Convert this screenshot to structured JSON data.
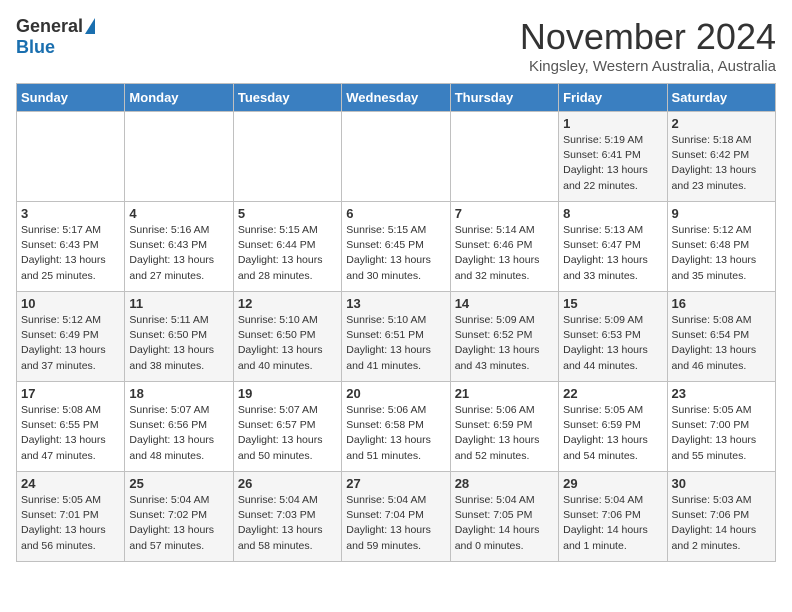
{
  "logo": {
    "general": "General",
    "blue": "Blue"
  },
  "title": "November 2024",
  "subtitle": "Kingsley, Western Australia, Australia",
  "headers": [
    "Sunday",
    "Monday",
    "Tuesday",
    "Wednesday",
    "Thursday",
    "Friday",
    "Saturday"
  ],
  "weeks": [
    [
      {
        "day": "",
        "info": ""
      },
      {
        "day": "",
        "info": ""
      },
      {
        "day": "",
        "info": ""
      },
      {
        "day": "",
        "info": ""
      },
      {
        "day": "",
        "info": ""
      },
      {
        "day": "1",
        "info": "Sunrise: 5:19 AM\nSunset: 6:41 PM\nDaylight: 13 hours\nand 22 minutes."
      },
      {
        "day": "2",
        "info": "Sunrise: 5:18 AM\nSunset: 6:42 PM\nDaylight: 13 hours\nand 23 minutes."
      }
    ],
    [
      {
        "day": "3",
        "info": "Sunrise: 5:17 AM\nSunset: 6:43 PM\nDaylight: 13 hours\nand 25 minutes."
      },
      {
        "day": "4",
        "info": "Sunrise: 5:16 AM\nSunset: 6:43 PM\nDaylight: 13 hours\nand 27 minutes."
      },
      {
        "day": "5",
        "info": "Sunrise: 5:15 AM\nSunset: 6:44 PM\nDaylight: 13 hours\nand 28 minutes."
      },
      {
        "day": "6",
        "info": "Sunrise: 5:15 AM\nSunset: 6:45 PM\nDaylight: 13 hours\nand 30 minutes."
      },
      {
        "day": "7",
        "info": "Sunrise: 5:14 AM\nSunset: 6:46 PM\nDaylight: 13 hours\nand 32 minutes."
      },
      {
        "day": "8",
        "info": "Sunrise: 5:13 AM\nSunset: 6:47 PM\nDaylight: 13 hours\nand 33 minutes."
      },
      {
        "day": "9",
        "info": "Sunrise: 5:12 AM\nSunset: 6:48 PM\nDaylight: 13 hours\nand 35 minutes."
      }
    ],
    [
      {
        "day": "10",
        "info": "Sunrise: 5:12 AM\nSunset: 6:49 PM\nDaylight: 13 hours\nand 37 minutes."
      },
      {
        "day": "11",
        "info": "Sunrise: 5:11 AM\nSunset: 6:50 PM\nDaylight: 13 hours\nand 38 minutes."
      },
      {
        "day": "12",
        "info": "Sunrise: 5:10 AM\nSunset: 6:50 PM\nDaylight: 13 hours\nand 40 minutes."
      },
      {
        "day": "13",
        "info": "Sunrise: 5:10 AM\nSunset: 6:51 PM\nDaylight: 13 hours\nand 41 minutes."
      },
      {
        "day": "14",
        "info": "Sunrise: 5:09 AM\nSunset: 6:52 PM\nDaylight: 13 hours\nand 43 minutes."
      },
      {
        "day": "15",
        "info": "Sunrise: 5:09 AM\nSunset: 6:53 PM\nDaylight: 13 hours\nand 44 minutes."
      },
      {
        "day": "16",
        "info": "Sunrise: 5:08 AM\nSunset: 6:54 PM\nDaylight: 13 hours\nand 46 minutes."
      }
    ],
    [
      {
        "day": "17",
        "info": "Sunrise: 5:08 AM\nSunset: 6:55 PM\nDaylight: 13 hours\nand 47 minutes."
      },
      {
        "day": "18",
        "info": "Sunrise: 5:07 AM\nSunset: 6:56 PM\nDaylight: 13 hours\nand 48 minutes."
      },
      {
        "day": "19",
        "info": "Sunrise: 5:07 AM\nSunset: 6:57 PM\nDaylight: 13 hours\nand 50 minutes."
      },
      {
        "day": "20",
        "info": "Sunrise: 5:06 AM\nSunset: 6:58 PM\nDaylight: 13 hours\nand 51 minutes."
      },
      {
        "day": "21",
        "info": "Sunrise: 5:06 AM\nSunset: 6:59 PM\nDaylight: 13 hours\nand 52 minutes."
      },
      {
        "day": "22",
        "info": "Sunrise: 5:05 AM\nSunset: 6:59 PM\nDaylight: 13 hours\nand 54 minutes."
      },
      {
        "day": "23",
        "info": "Sunrise: 5:05 AM\nSunset: 7:00 PM\nDaylight: 13 hours\nand 55 minutes."
      }
    ],
    [
      {
        "day": "24",
        "info": "Sunrise: 5:05 AM\nSunset: 7:01 PM\nDaylight: 13 hours\nand 56 minutes."
      },
      {
        "day": "25",
        "info": "Sunrise: 5:04 AM\nSunset: 7:02 PM\nDaylight: 13 hours\nand 57 minutes."
      },
      {
        "day": "26",
        "info": "Sunrise: 5:04 AM\nSunset: 7:03 PM\nDaylight: 13 hours\nand 58 minutes."
      },
      {
        "day": "27",
        "info": "Sunrise: 5:04 AM\nSunset: 7:04 PM\nDaylight: 13 hours\nand 59 minutes."
      },
      {
        "day": "28",
        "info": "Sunrise: 5:04 AM\nSunset: 7:05 PM\nDaylight: 14 hours\nand 0 minutes."
      },
      {
        "day": "29",
        "info": "Sunrise: 5:04 AM\nSunset: 7:06 PM\nDaylight: 14 hours\nand 1 minute."
      },
      {
        "day": "30",
        "info": "Sunrise: 5:03 AM\nSunset: 7:06 PM\nDaylight: 14 hours\nand 2 minutes."
      }
    ]
  ]
}
